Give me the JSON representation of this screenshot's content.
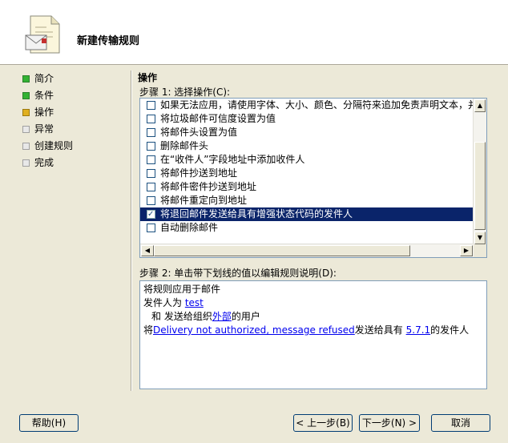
{
  "header": {
    "title": "新建传输规则"
  },
  "steps": [
    {
      "label": "简介",
      "status": "done"
    },
    {
      "label": "条件",
      "status": "done"
    },
    {
      "label": "操作",
      "status": "current"
    },
    {
      "label": "异常",
      "status": "pending"
    },
    {
      "label": "创建规则",
      "status": "pending"
    },
    {
      "label": "完成",
      "status": "pending"
    }
  ],
  "main": {
    "title": "操作",
    "step1_label": "步骤 1: 选择操作(C):",
    "step2_label": "步骤 2: 单击带下划线的值以编辑规则说明(D):"
  },
  "actions": [
    {
      "label": "如果无法应用，请使用字体、大小、颜色、分隔符来追加免责声明文本，并",
      "checked": false
    },
    {
      "label": "将垃圾邮件可信度设置为值",
      "checked": false
    },
    {
      "label": "将邮件头设置为值",
      "checked": false
    },
    {
      "label": "删除邮件头",
      "checked": false
    },
    {
      "label": "在“收件人”字段地址中添加收件人",
      "checked": false
    },
    {
      "label": "将邮件抄送到地址",
      "checked": false
    },
    {
      "label": "将邮件密件抄送到地址",
      "checked": false
    },
    {
      "label": "将邮件重定向到地址",
      "checked": false
    },
    {
      "label": "将退回邮件发送给具有增强状态代码的发件人",
      "checked": true
    },
    {
      "label": "自动删除邮件",
      "checked": false
    }
  ],
  "description": {
    "line1": "将规则应用于邮件",
    "line2_prefix": "发件人为 ",
    "line2_link": "test",
    "line3_prefix": "和 发送给组织",
    "line3_link": "外部",
    "line3_suffix": "的用户",
    "line4_prefix": "将",
    "line4_link1": "Delivery not authorized, message refused",
    "line4_mid": "发送给具有 ",
    "line4_link2": "5.7.1",
    "line4_suffix": "的发件人"
  },
  "buttons": {
    "help": "帮助(H)",
    "back": "< 上一步(B)",
    "next": "下一步(N) >",
    "cancel": "取消"
  }
}
